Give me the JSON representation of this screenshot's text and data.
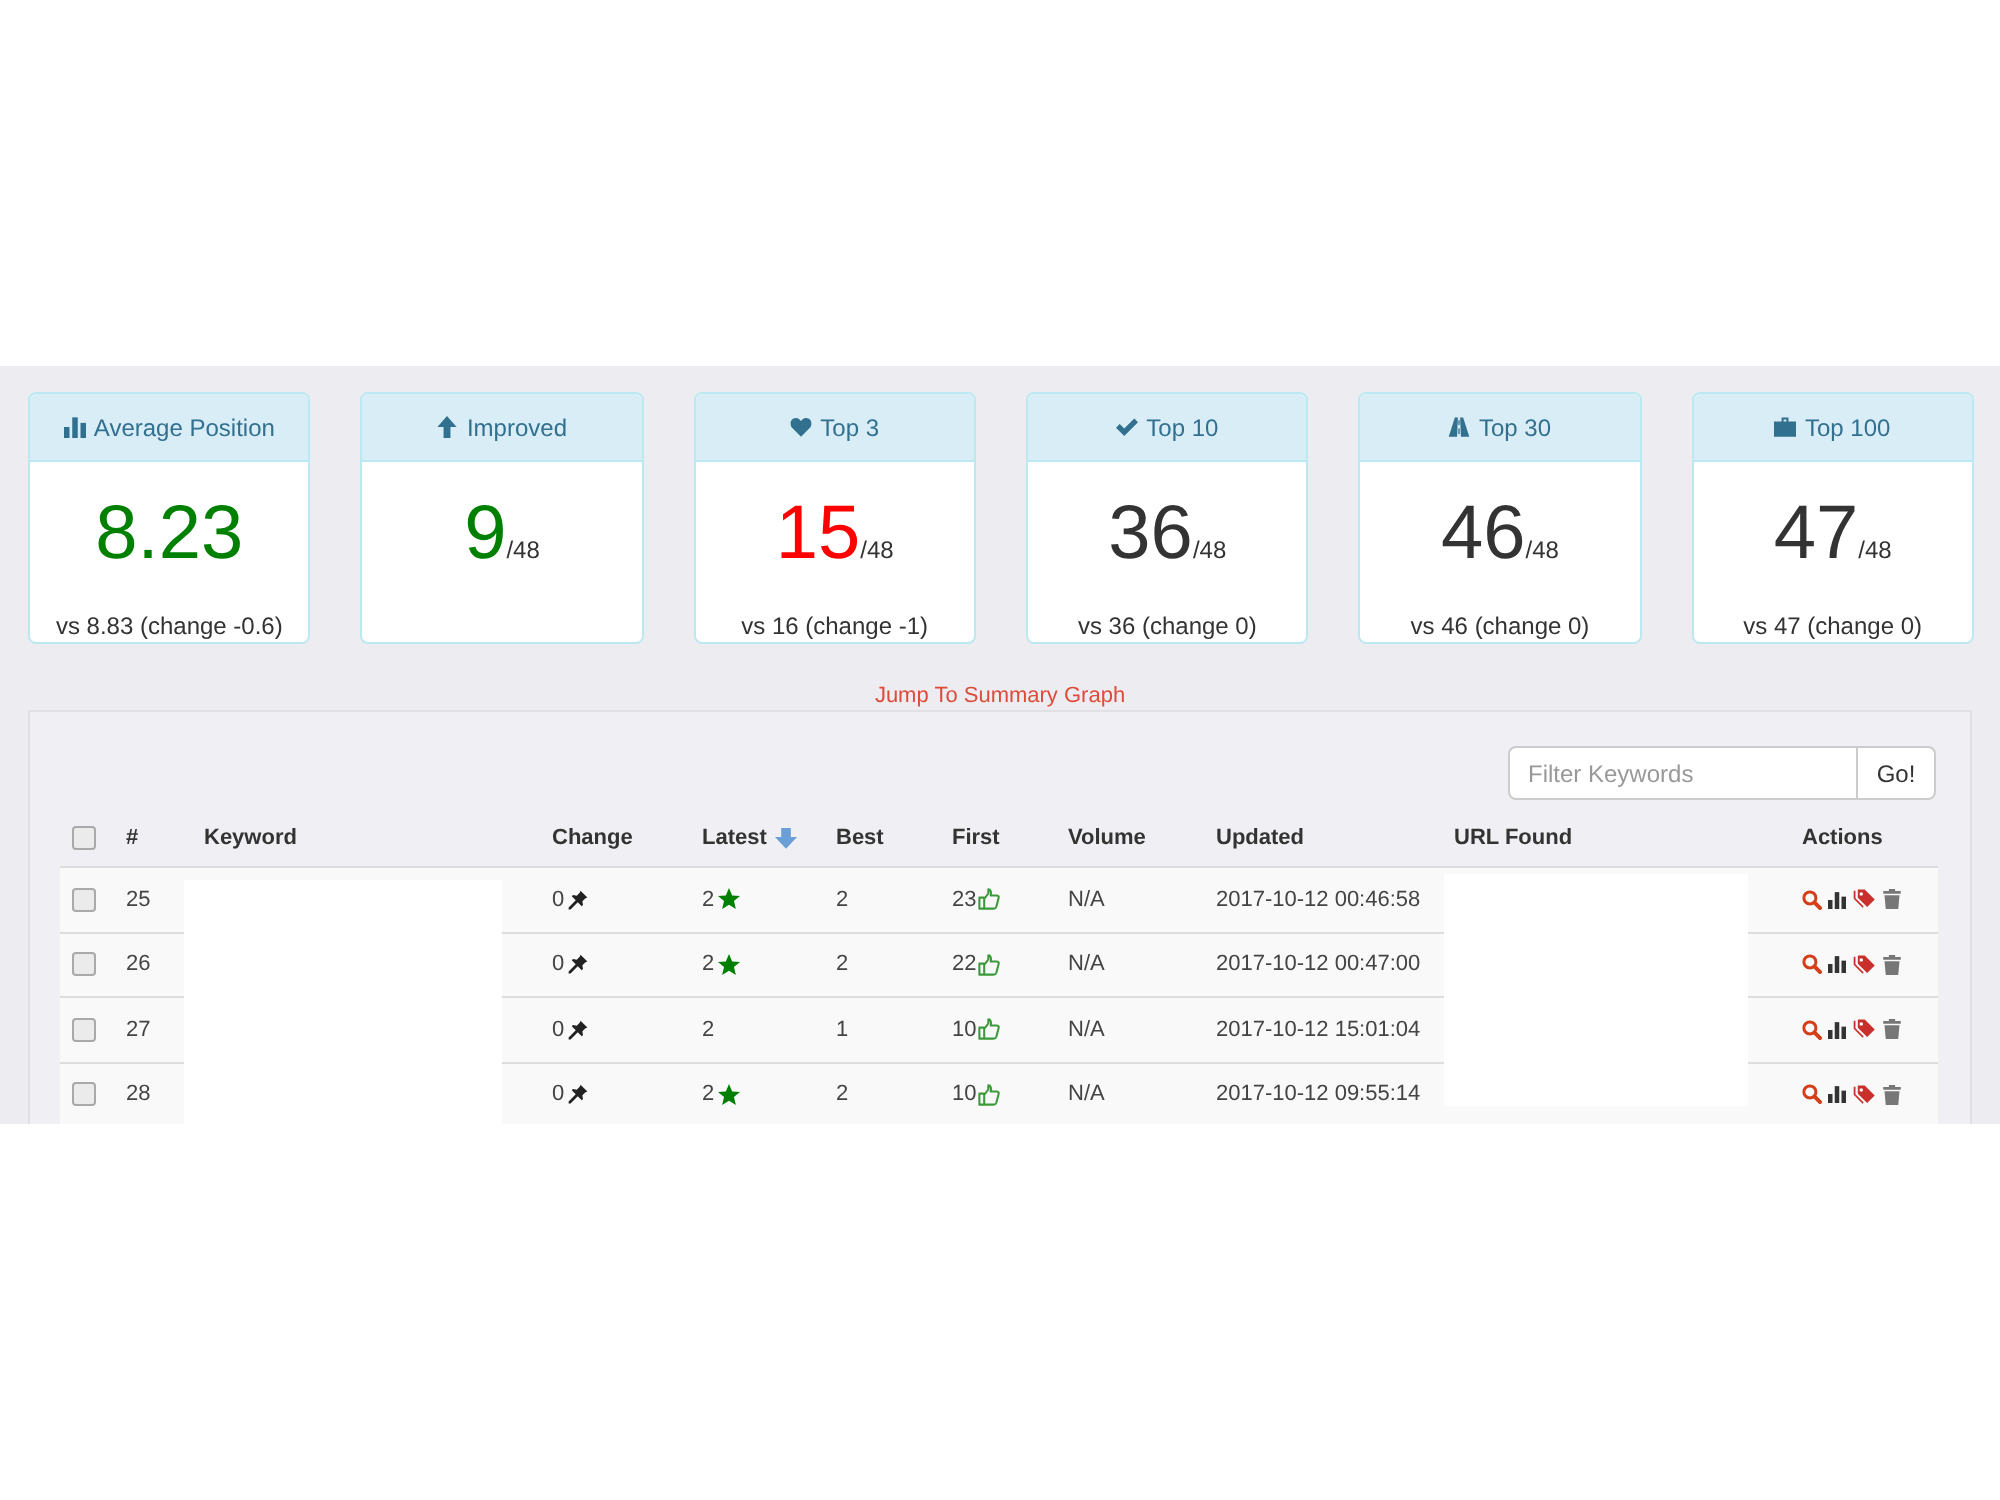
{
  "stats": [
    {
      "title": "Average Position",
      "value": "8.23",
      "color": "#008000",
      "comparison": "vs 8.83 (change -0.6)"
    },
    {
      "title": "Improved",
      "value": "9",
      "total": "/48",
      "color": "#008000"
    },
    {
      "title": "Top 3",
      "value": "15",
      "total": "/48",
      "color": "#ff0000",
      "comparison": "vs 16 (change -1)"
    },
    {
      "title": "Top 10",
      "value": "36",
      "total": "/48",
      "color": "#333333",
      "comparison": "vs 36 (change 0)"
    },
    {
      "title": "Top 30",
      "value": "46",
      "total": "/48",
      "color": "#333333",
      "comparison": "vs 46 (change 0)"
    },
    {
      "title": "Top 100",
      "value": "47",
      "total": "/48",
      "color": "#333333",
      "comparison": "vs 47 (change 0)"
    }
  ],
  "summary_link": "Jump To Summary Graph",
  "filter": {
    "placeholder": "Filter Keywords",
    "button": "Go!"
  },
  "table": {
    "select_all": {
      "checked": false
    },
    "columns": [
      {
        "label": "#",
        "sorted": false
      },
      {
        "label": "Keyword",
        "sorted": false
      },
      {
        "label": "Change",
        "sorted": false
      },
      {
        "label": "Latest",
        "sorted": true
      },
      {
        "label": "Best",
        "sorted": false
      },
      {
        "label": "First",
        "sorted": false
      },
      {
        "label": "Volume",
        "sorted": false
      },
      {
        "label": "Updated",
        "sorted": false
      },
      {
        "label": "URL Found",
        "sorted": false
      },
      {
        "label": "Actions",
        "sorted": false
      }
    ],
    "rows": [
      {
        "checked": false,
        "number": "25",
        "change": "0",
        "latest": "2",
        "starred": true,
        "best": "2",
        "first": "23",
        "volume": "N/A",
        "updated": "2017-10-12 00:46:58"
      },
      {
        "checked": false,
        "number": "26",
        "change": "0",
        "latest": "2",
        "starred": true,
        "best": "2",
        "first": "22",
        "volume": "N/A",
        "updated": "2017-10-12 00:47:00"
      },
      {
        "checked": false,
        "number": "27",
        "change": "0",
        "latest": "2",
        "starred": false,
        "best": "1",
        "first": "10",
        "volume": "N/A",
        "updated": "2017-10-12 15:01:04"
      },
      {
        "checked": false,
        "number": "28",
        "change": "0",
        "latest": "2",
        "starred": true,
        "best": "2",
        "first": "10",
        "volume": "N/A",
        "updated": "2017-10-12 09:55:14"
      }
    ]
  }
}
